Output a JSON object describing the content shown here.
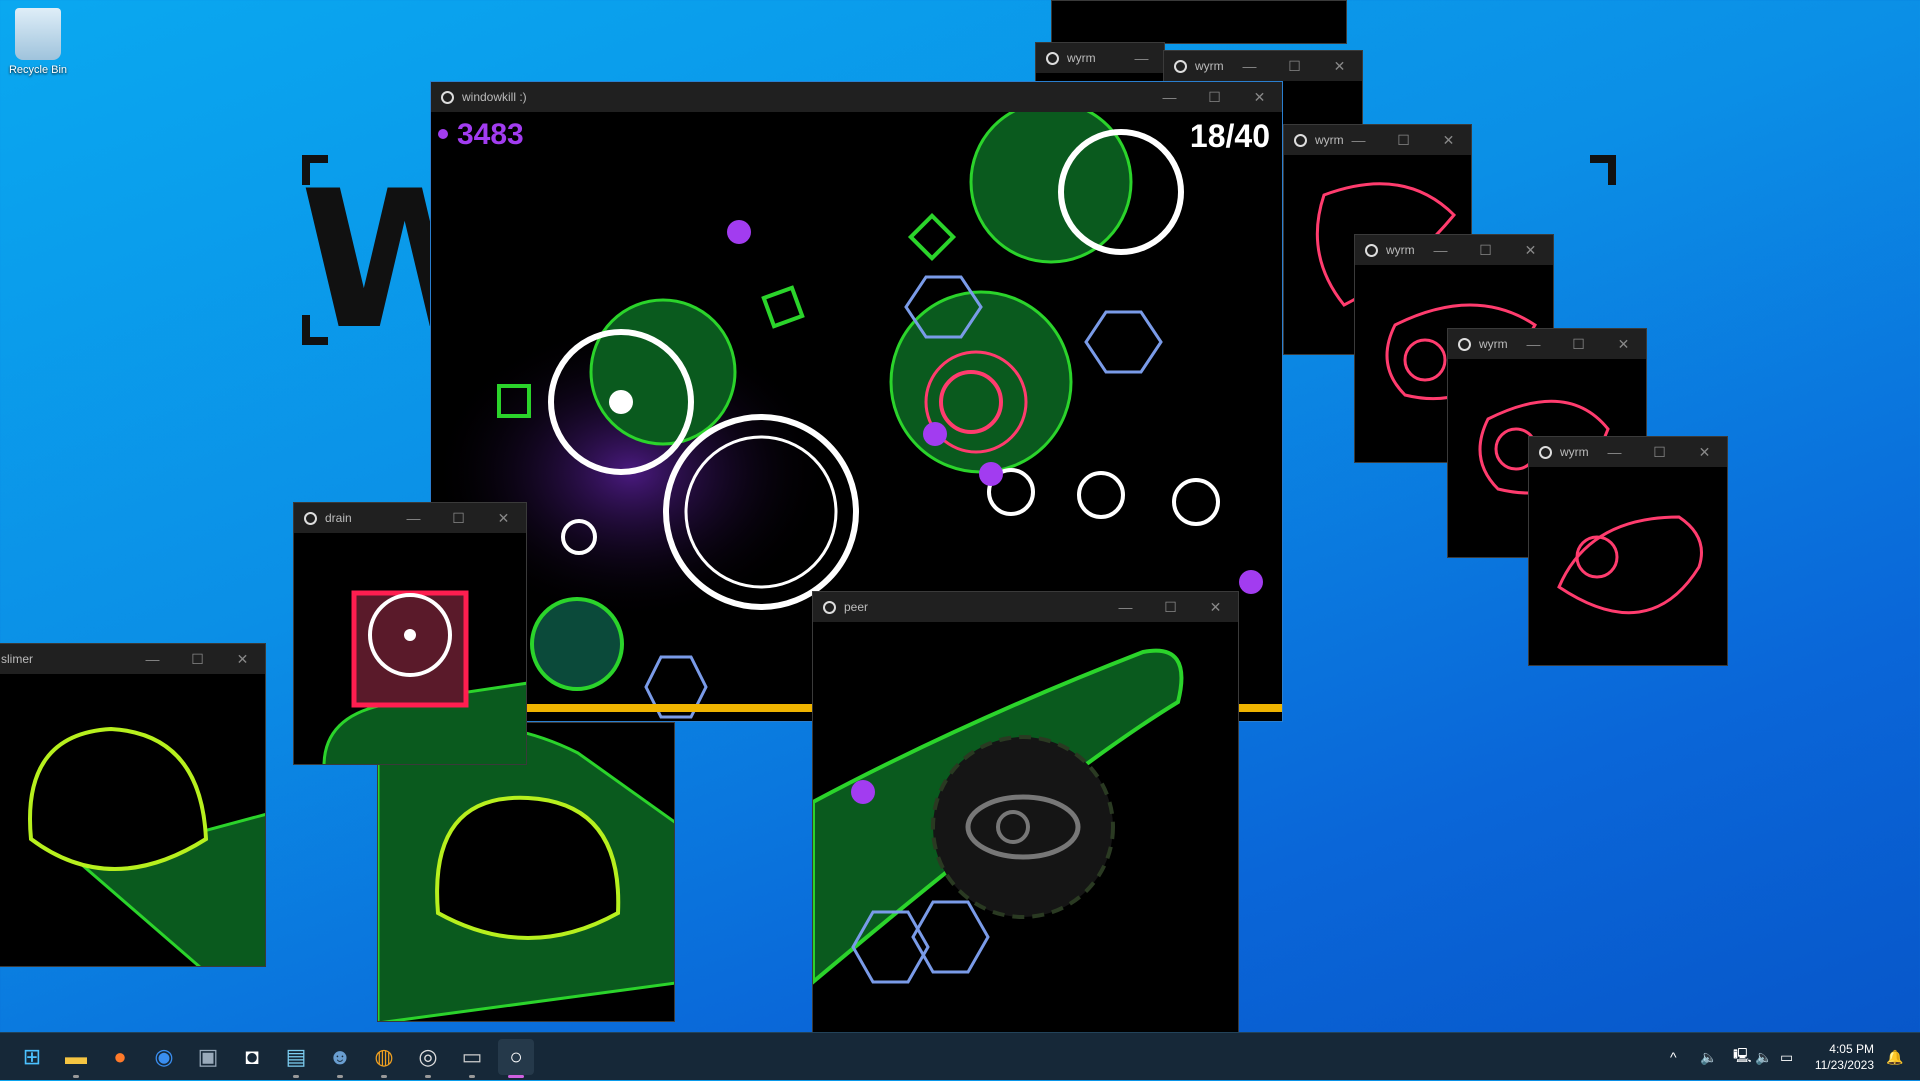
{
  "desktop": {
    "recycle_bin_label": "Recycle Bin",
    "logo_text": "W"
  },
  "windows": {
    "main": {
      "title": "windowkill :)",
      "score": "3483",
      "wave": "18/40",
      "score_color": "#a23cf0"
    },
    "drain": {
      "title": "drain"
    },
    "slimer": {
      "title": "slimer"
    },
    "peer": {
      "title": "peer"
    },
    "wyrm": [
      "wyrm",
      "wyrm",
      "wyrm",
      "wyrm",
      "wyrm",
      "wyrm"
    ]
  },
  "window_controls": {
    "minimize": "—",
    "maximize": "☐",
    "close": "✕"
  },
  "taskbar": {
    "apps": [
      "start-icon",
      "file-explorer-icon",
      "firefox-icon",
      "chrome-icon",
      "paint-icon",
      "app-icon",
      "notepad-icon",
      "godot-icon",
      "audacity-icon",
      "obs-icon",
      "terminal-icon",
      "windowkill-icon"
    ],
    "tray": {
      "chevron": "^",
      "time": "4:05 PM",
      "date": "11/23/2023"
    }
  },
  "colors": {
    "green": "#0a5a1e",
    "lime": "#b7f01e",
    "pink": "#ff3c6e",
    "purple": "#a23cf0",
    "blue": "#7a9be8"
  }
}
